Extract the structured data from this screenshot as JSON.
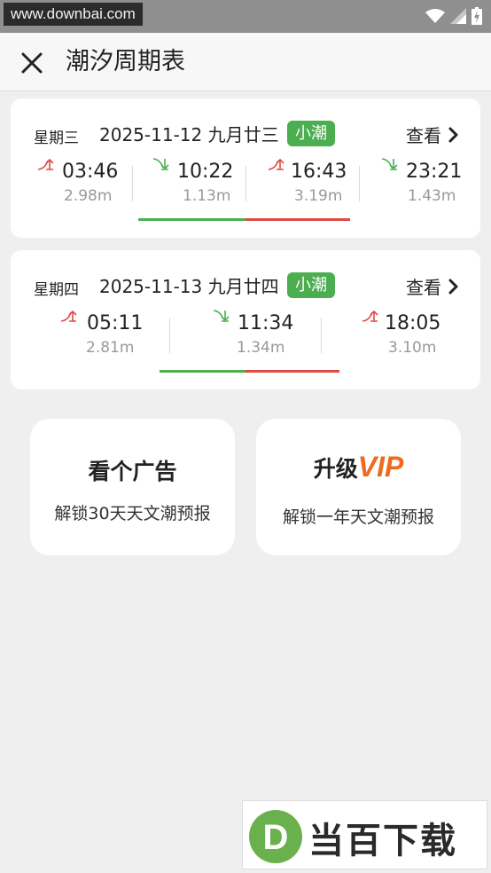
{
  "status_bar": {
    "watermark_url": "www.downbai.com"
  },
  "header": {
    "title": "潮汐周期表"
  },
  "cards": [
    {
      "weekday": "星期三",
      "date": "2025-11-12 九月廿三",
      "badge": "小潮",
      "view_label": "查看",
      "tides": [
        {
          "type": "high",
          "time": "03:46",
          "height": "2.98m"
        },
        {
          "type": "low",
          "time": "10:22",
          "height": "1.13m"
        },
        {
          "type": "high",
          "time": "16:43",
          "height": "3.19m"
        },
        {
          "type": "low",
          "time": "23:21",
          "height": "1.43m"
        }
      ]
    },
    {
      "weekday": "星期四",
      "date": "2025-11-13 九月廿四",
      "badge": "小潮",
      "view_label": "查看",
      "tides": [
        {
          "type": "high",
          "time": "05:11",
          "height": "2.81m"
        },
        {
          "type": "low",
          "time": "11:34",
          "height": "1.34m"
        },
        {
          "type": "high",
          "time": "18:05",
          "height": "3.10m"
        }
      ]
    }
  ],
  "promos": {
    "ad": {
      "title": "看个广告",
      "subtitle": "解锁30天天文潮预报"
    },
    "vip": {
      "title_prefix": "升级",
      "title_vip": "VIP",
      "subtitle": "解锁一年天文潮预报"
    }
  },
  "brand_watermark": {
    "text": "当百下载",
    "logo_letter": "D"
  },
  "colors": {
    "badge_green": "#4cae50",
    "high_tide_red": "#e04a45",
    "low_tide_green": "#4caf50",
    "vip_orange": "#ef6a1c"
  },
  "icons": {
    "high_tide": "tide-rising-icon",
    "low_tide": "tide-falling-icon"
  }
}
